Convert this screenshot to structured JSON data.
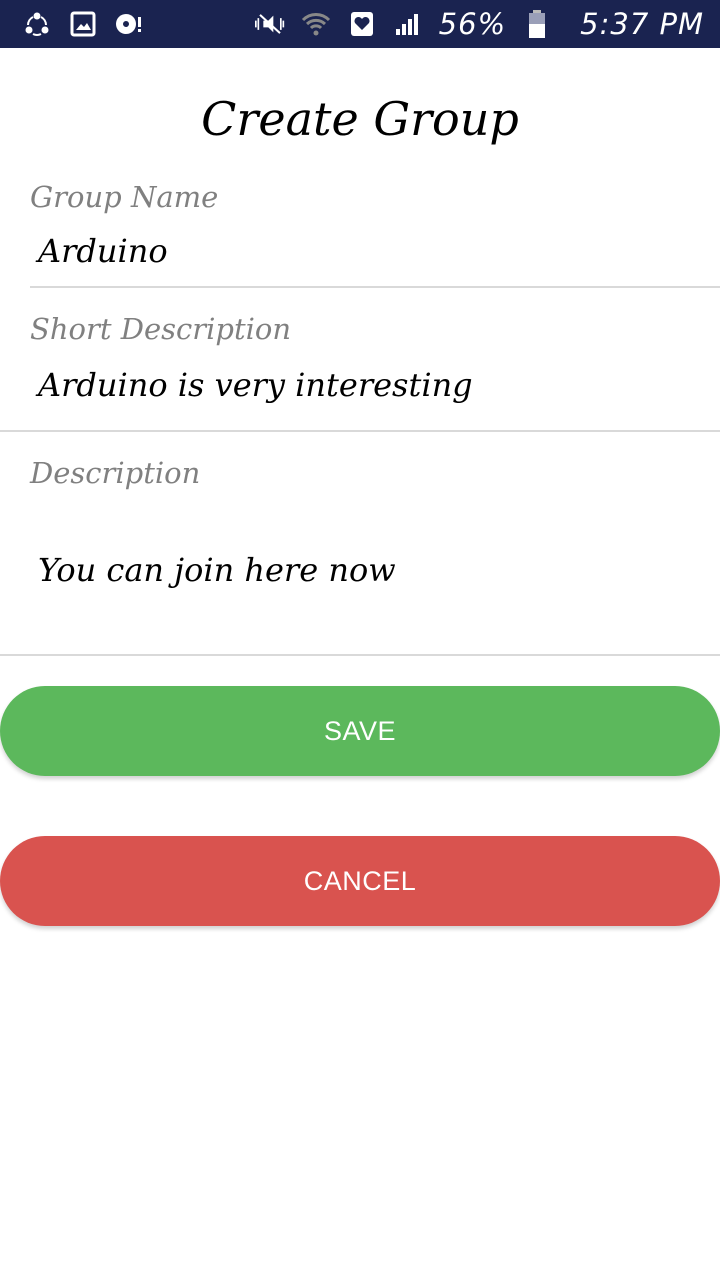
{
  "status_bar": {
    "left_icons": [
      "sync-icon",
      "image-icon",
      "media-icon"
    ],
    "right_icons": [
      "mute-vibrate-icon",
      "wifi-icon",
      "heart-shield-icon",
      "signal-icon"
    ],
    "battery_percent": "56%",
    "battery_level": 0.56,
    "time": "5:37 PM",
    "background_color": "#1a2350"
  },
  "page": {
    "title": "Create Group"
  },
  "form": {
    "group_name_label": "Group Name",
    "group_name_value": "Arduino",
    "short_description_label": "Short Description",
    "short_description_value": "Arduino is very interesting",
    "description_label": "Description",
    "description_value": "You can join here now"
  },
  "buttons": {
    "save_label": "SAVE",
    "save_color": "#5cb85c",
    "cancel_label": "CANCEL",
    "cancel_color": "#d9534f"
  }
}
